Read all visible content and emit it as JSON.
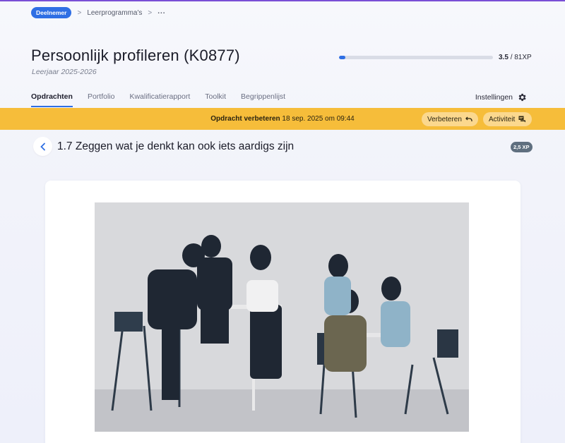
{
  "breadcrumb": {
    "badge": "Deelnemer",
    "separator": ">",
    "item": "Leerprogramma's",
    "more": "..."
  },
  "header": {
    "title": "Persoonlijk profileren (K0877)",
    "subtitle": "Leerjaar 2025-2026",
    "xp_current": "3.5",
    "xp_total": "/ 81XP",
    "progress_fraction": 0.043
  },
  "tabs": [
    {
      "label": "Opdrachten",
      "active": true
    },
    {
      "label": "Portfolio",
      "active": false
    },
    {
      "label": "Kwalificatierapport",
      "active": false
    },
    {
      "label": "Toolkit",
      "active": false
    },
    {
      "label": "Begrippenlijst",
      "active": false
    }
  ],
  "settings": {
    "label": "Instellingen",
    "icon": "gear-icon"
  },
  "alert": {
    "bold": "Opdracht verbeteren",
    "date": "18 sep. 2025 om 09:44",
    "improve_label": "Verbeteren",
    "activity_label": "Activiteit",
    "color": "#f6bd3a"
  },
  "assignment": {
    "title": "1.7 Zeggen wat je denkt kan ook iets aardigs zijn",
    "xp": "2,5 XP"
  },
  "colors": {
    "accent": "#2f6fe4",
    "alert": "#f6bd3a",
    "background": "#eceff9"
  }
}
